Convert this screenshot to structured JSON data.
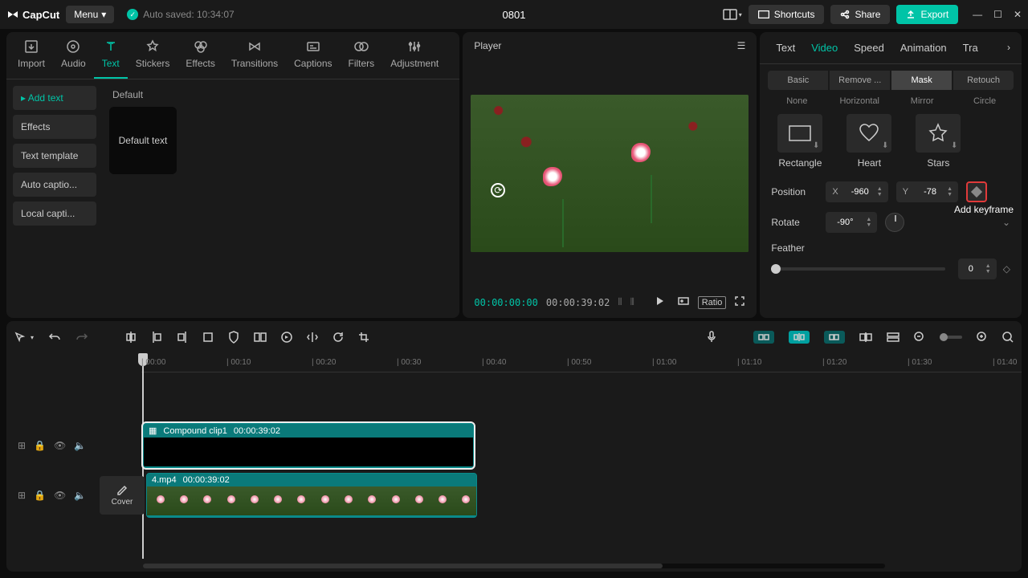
{
  "app": {
    "name": "CapCut",
    "menu": "Menu",
    "auto_saved": "Auto saved: 10:34:07",
    "project": "0801"
  },
  "top": {
    "shortcuts": "Shortcuts",
    "share": "Share",
    "export": "Export"
  },
  "lib": {
    "tabs": [
      "Import",
      "Audio",
      "Text",
      "Stickers",
      "Effects",
      "Transitions",
      "Captions",
      "Filters",
      "Adjustment"
    ],
    "side": [
      "Add text",
      "Effects",
      "Text template",
      "Auto captio...",
      "Local capti..."
    ],
    "default_label": "Default",
    "default_text": "Default text"
  },
  "player": {
    "title": "Player",
    "time_cur": "00:00:00:00",
    "time_dur": "00:00:39:02",
    "ratio": "Ratio"
  },
  "props": {
    "tabs": [
      "Text",
      "Video",
      "Speed",
      "Animation",
      "Tra"
    ],
    "sub": [
      "Basic",
      "Remove ...",
      "Mask",
      "Retouch"
    ],
    "mask_top": [
      "None",
      "Horizontal",
      "Mirror",
      "Circle"
    ],
    "shapes": [
      "Rectangle",
      "Heart",
      "Stars"
    ],
    "position": "Position",
    "x": "X",
    "xval": "-960",
    "y": "Y",
    "yval": "-78",
    "rotate": "Rotate",
    "rotval": "-90°",
    "feather": "Feather",
    "featherval": "0",
    "tooltip": "Add keyframe"
  },
  "timeline": {
    "ticks": [
      "00:00",
      "00:10",
      "00:20",
      "00:30",
      "00:40",
      "00:50",
      "01:00",
      "01:10",
      "01:20",
      "01:30",
      "01:40"
    ],
    "cover": "Cover",
    "clip1": {
      "name": "Compound clip1",
      "dur": "00:00:39:02"
    },
    "clip2": {
      "name": "4.mp4",
      "dur": "00:00:39:02"
    }
  }
}
